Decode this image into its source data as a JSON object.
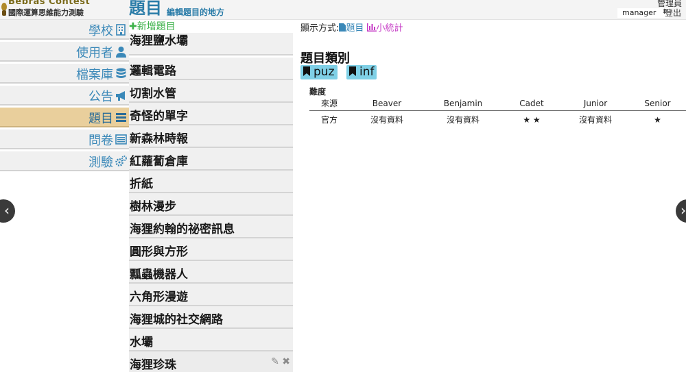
{
  "header": {
    "logo_line1": "Bebras Contest",
    "logo_line2": "國際運算思維能力測驗",
    "title": "題目",
    "subtitle": "編輯題目的地方",
    "admin_label": "管理員",
    "user_select_value": "manager",
    "logout_label": "登出"
  },
  "sidebar": {
    "items": [
      {
        "label": "學校",
        "icon": "building-icon"
      },
      {
        "label": "使用者",
        "icon": "user-icon"
      },
      {
        "label": "檔案庫",
        "icon": "database-icon"
      },
      {
        "label": "公告",
        "icon": "megaphone-icon"
      },
      {
        "label": "題目",
        "icon": "list-icon",
        "active": true
      },
      {
        "label": "問卷",
        "icon": "form-icon"
      },
      {
        "label": "測驗",
        "icon": "gears-icon"
      }
    ]
  },
  "problems": {
    "add_label": "新增題目",
    "items": [
      "海狸鹽水壩",
      "邏輯電路",
      "切割水管",
      "奇怪的單字",
      "新森林時報",
      "紅蘿蔔倉庫",
      "折紙",
      "樹林漫步",
      "海狸約翰的祕密訊息",
      "圓形與方形",
      "瓢蟲機器人",
      "六角形漫遊",
      "海狸城的社交網路",
      "水壩",
      "海狸珍珠"
    ]
  },
  "main": {
    "display_mode_label": "顯示方式:",
    "display_options": [
      "題目",
      "小統計"
    ],
    "category_title": "題目類別",
    "tags": [
      "puz",
      "inf"
    ],
    "difficulty_label": "難度",
    "table": {
      "headers": [
        "來源",
        "Beaver",
        "Benjamin",
        "Cadet",
        "Junior",
        "Senior"
      ],
      "rows": [
        [
          "官方",
          "沒有資料",
          "沒有資料",
          "★ ★",
          "沒有資料",
          "★"
        ]
      ]
    }
  },
  "colors": {
    "nav_text": "#3a88b8",
    "active_nav_bg": "#e9cf9c",
    "add_green": "#3db24a",
    "tag_bg": "#7fd0e6",
    "stats_magenta": "#c53ac5"
  },
  "nav_arrows": {
    "prev": "‹",
    "next": "›"
  }
}
